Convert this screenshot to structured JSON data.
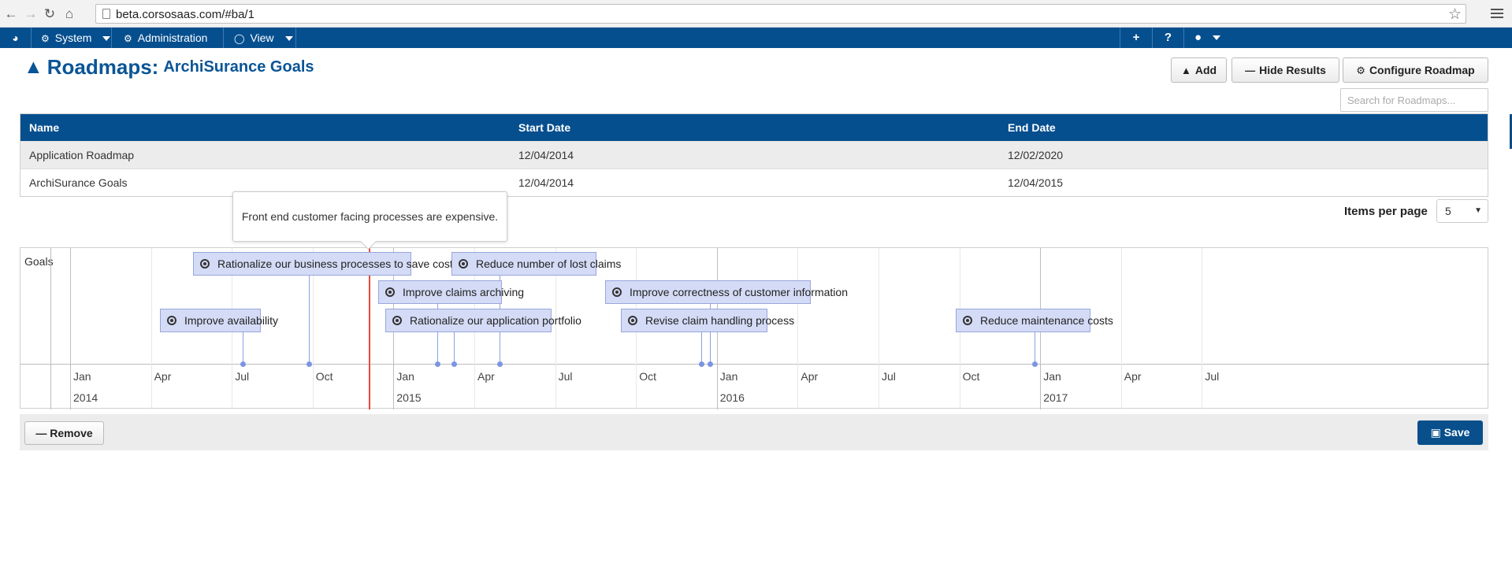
{
  "browser": {
    "url": "beta.corsosaas.com/#ba/1"
  },
  "nav": {
    "system": "System",
    "administration": "Administration",
    "view": "View",
    "add_icon": "+",
    "help_icon": "?"
  },
  "header": {
    "title": "Roadmaps:",
    "subtitle": "ArchiSurance Goals",
    "add_label": "Add",
    "hide_label": "Hide Results",
    "configure_label": "Configure Roadmap",
    "search_placeholder": "Search for Roadmaps..."
  },
  "table": {
    "columns": [
      "Name",
      "Start Date",
      "End Date"
    ],
    "rows": [
      {
        "name": "Application Roadmap",
        "start": "12/04/2014",
        "end": "12/02/2020"
      },
      {
        "name": "ArchiSurance Goals",
        "start": "12/04/2014",
        "end": "12/04/2015"
      }
    ]
  },
  "pagination": {
    "label": "Items per page",
    "value": "5"
  },
  "tooltip": "Front end customer facing processes are expensive.",
  "timeline": {
    "lane": "Goals",
    "months": [
      "Jan",
      "Apr",
      "Jul",
      "Oct",
      "Jan",
      "Apr",
      "Jul",
      "Oct",
      "Jan",
      "Apr",
      "Jul",
      "Oct",
      "Jan",
      "Apr",
      "Jul"
    ],
    "years": [
      "2014",
      "2015",
      "2016",
      "2017"
    ],
    "items": [
      {
        "label": "Rationalize our business processes to save cost",
        "date": "2014-09-28"
      },
      {
        "label": "Reduce number of lost claims",
        "date": "2015-05-01"
      },
      {
        "label": "Improve claims archiving",
        "date": "2015-02-20"
      },
      {
        "label": "Improve correctness of customer information",
        "date": "2015-12-25"
      },
      {
        "label": "Improve availability",
        "date": "2014-07-15"
      },
      {
        "label": "Rationalize our application portfolio",
        "date": "2015-03-10"
      },
      {
        "label": "Revise claim handling process",
        "date": "2015-12-15"
      },
      {
        "label": "Reduce maintenance costs",
        "date": "2016-12-25"
      }
    ],
    "current_date": "2014-12-04"
  },
  "footer": {
    "remove_label": "Remove",
    "save_label": "Save"
  },
  "colors": {
    "brand": "#064f8f",
    "timeline_item": "#d4dbf6",
    "current_marker": "#e84a3a"
  }
}
